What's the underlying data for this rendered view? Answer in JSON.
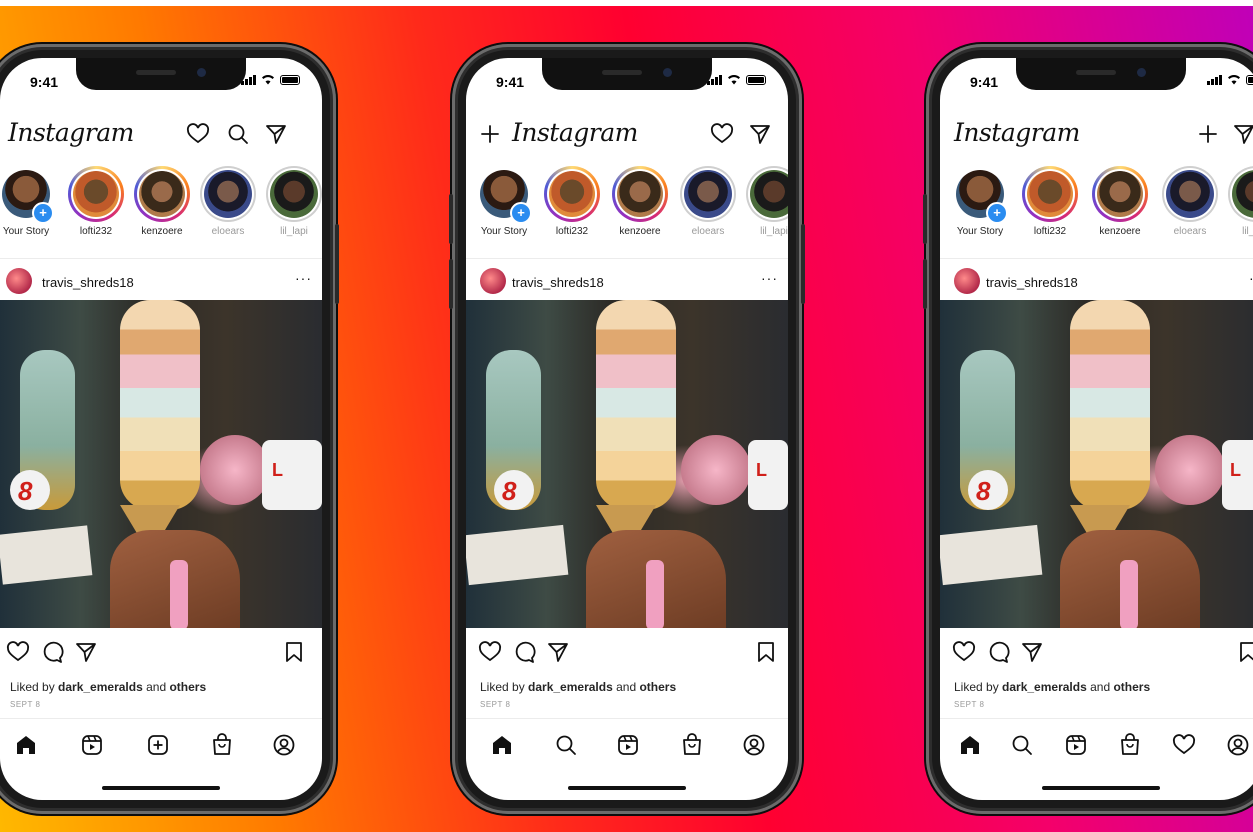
{
  "status": {
    "time": "9:41"
  },
  "app": {
    "logo": "Instagram"
  },
  "stories": [
    {
      "label": "Your Story",
      "type": "own"
    },
    {
      "label": "lofti232",
      "type": "unseen"
    },
    {
      "label": "kenzoere",
      "type": "unseen"
    },
    {
      "label": "eloears",
      "type": "seen"
    },
    {
      "label": "lil_lapi",
      "type": "seen"
    }
  ],
  "post": {
    "username": "travis_shreds18",
    "more": "···",
    "liked_prefix": "Liked by ",
    "liked_user": "dark_emeralds",
    "liked_mid": " and ",
    "liked_others": "others",
    "date": "SEPT 8"
  },
  "phones": [
    {
      "header_icons": [
        "heart-icon",
        "search-icon",
        "direct-icon"
      ],
      "tabs": [
        "home-icon",
        "reels-icon",
        "create-icon",
        "shop-icon",
        "profile-icon"
      ]
    },
    {
      "header_icons": [
        "create-icon",
        "heart-icon",
        "direct-icon"
      ],
      "tabs": [
        "home-icon",
        "search-icon",
        "reels-icon",
        "shop-icon",
        "profile-icon"
      ]
    },
    {
      "header_icons": [
        "create-icon",
        "direct-icon"
      ],
      "tabs": [
        "home-icon",
        "search-icon",
        "reels-icon",
        "shop-icon",
        "heart-icon",
        "profile-icon"
      ]
    }
  ],
  "colors": {
    "story_ring": "#d62976",
    "badge_blue": "#2a8cf0"
  }
}
